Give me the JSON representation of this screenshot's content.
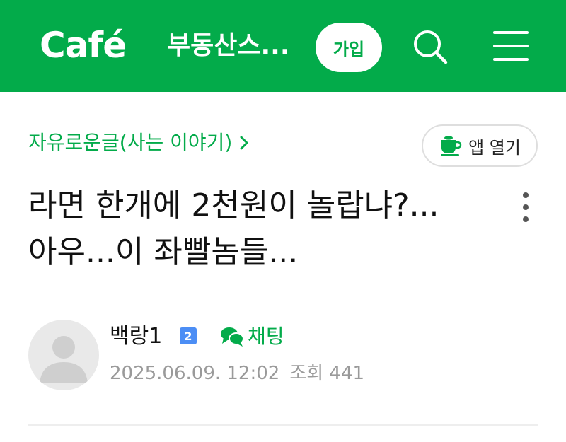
{
  "header": {
    "logo": "Café",
    "cafe_name": "부동산스...",
    "join_label": "가입",
    "icons": {
      "search": "search-icon",
      "menu": "menu-icon"
    },
    "background": "#03ab4a"
  },
  "board": {
    "breadcrumb": "자유로운글(사는 이야기)",
    "breadcrumb_icon": "chevron-right-icon",
    "app_open_label": "앱 열기",
    "app_open_icon": "cup-icon"
  },
  "post": {
    "title": "라면 한개에 2천원이 놀랍냐?...아우...이 좌빨놈들...",
    "more_icon": "more-vertical-icon"
  },
  "author": {
    "name": "백랑1",
    "level": "2",
    "chat_label": "채팅",
    "date": "2025.06.09. 12:02",
    "views": "조회 441"
  },
  "colors": {
    "accent": "#03ab4a",
    "meta": "#9a9a9a",
    "badge": "#4c8ef5"
  }
}
